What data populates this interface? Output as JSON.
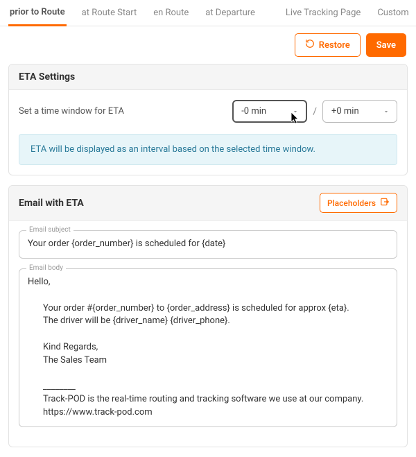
{
  "tabs": {
    "items": [
      {
        "label": "prior to Route",
        "active": true
      },
      {
        "label": "at Route Start",
        "active": false
      },
      {
        "label": "en Route",
        "active": false
      },
      {
        "label": "at Departure",
        "active": false
      },
      {
        "label": "Live Tracking Page",
        "active": false
      },
      {
        "label": "Custom",
        "active": false
      }
    ]
  },
  "actions": {
    "restore": "Restore",
    "save": "Save"
  },
  "eta": {
    "title": "ETA Settings",
    "label": "Set a time window for ETA",
    "minus": "-0 min",
    "separator": "/",
    "plus": "+0 min",
    "info": "ETA will be displayed as an interval based on the selected time window."
  },
  "email": {
    "title": "Email with ETA",
    "placeholders_btn": "Placeholders",
    "subject_label": "Email subject",
    "subject_value": "Your order {order_number} is scheduled for {date}",
    "body_label": "Email body",
    "body": {
      "greeting": "Hello,",
      "line1": "Your order #{order_number} to {order_address} is scheduled for approx {eta}.",
      "line2": "The driver will be {driver_name} {driver_phone}.",
      "regards1": "Kind Regards,",
      "regards2": "The Sales Team",
      "sep": "________",
      "footer1": "Track-POD is the real-time routing and tracking software we use at our company.",
      "footer2": "https://www.track-pod.com"
    }
  }
}
